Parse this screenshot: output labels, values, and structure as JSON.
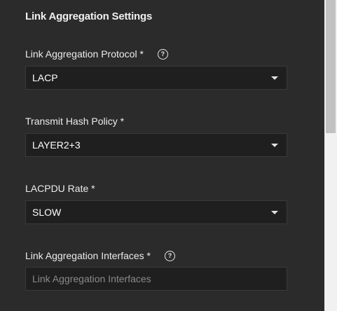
{
  "section": {
    "title": "Link Aggregation Settings"
  },
  "fields": {
    "protocol": {
      "label": "Link Aggregation Protocol *",
      "value": "LACP",
      "help_icon": "help-circle-icon"
    },
    "hash_policy": {
      "label": "Transmit Hash Policy *",
      "value": "LAYER2+3"
    },
    "lacpdu_rate": {
      "label": "LACPDU Rate *",
      "value": "SLOW"
    },
    "interfaces": {
      "label": "Link Aggregation Interfaces *",
      "placeholder": "Link Aggregation Interfaces",
      "help_icon": "help-circle-icon"
    }
  },
  "colors": {
    "background": "#2b2b2b",
    "field_background": "#1f1f1f",
    "scrollbar_track": "#f1f1f1",
    "scrollbar_thumb": "#c1c1c1"
  }
}
